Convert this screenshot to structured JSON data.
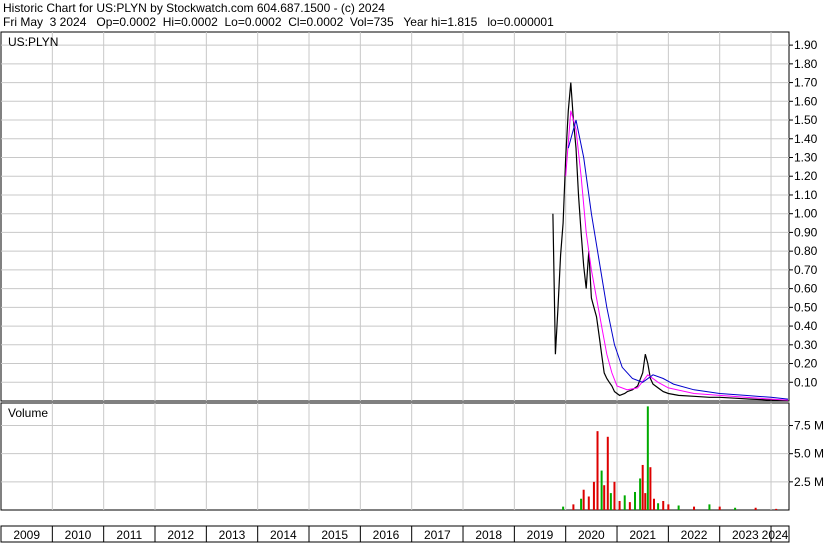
{
  "header": {
    "line1": "Historic Chart for US:PLYN by Stockwatch.com 604.687.1500 - (c) 2024",
    "line2": "Fri May  3 2024   Op=0.0002  Hi=0.0002  Lo=0.0002  Cl=0.0002  Vol=735   Year hi=1.815   lo=0.000001"
  },
  "colors": {
    "price": "#000000",
    "ma_short": "#ff00ff",
    "ma_long": "#0000cc",
    "vol_up": "#00aa00",
    "vol_down": "#dd0000",
    "grid": "#c8c8c8"
  },
  "chart_data": [
    {
      "type": "line",
      "title": "US:PLYN",
      "ylim": [
        0,
        1.97
      ],
      "ytick_labels": [
        "0.10",
        "0.20",
        "0.30",
        "0.40",
        "0.50",
        "0.60",
        "0.70",
        "0.80",
        "0.90",
        "1.00",
        "1.10",
        "1.20",
        "1.30",
        "1.40",
        "1.50",
        "1.60",
        "1.70",
        "1.80",
        "1.90"
      ],
      "xtick_labels": [
        "2009",
        "2010",
        "2011",
        "2012",
        "2013",
        "2014",
        "2015",
        "2016",
        "2017",
        "2018",
        "2019",
        "2020",
        "2021",
        "2022",
        "2023",
        "2024"
      ],
      "xlim": [
        2009.0,
        2024.35
      ],
      "series": [
        {
          "values_x": [
            2019.75,
            2019.8,
            2019.85,
            2019.9,
            2019.95,
            2020.0,
            2020.05,
            2020.1,
            2020.15,
            2020.2,
            2020.25,
            2020.3,
            2020.35,
            2020.4,
            2020.45,
            2020.5,
            2020.55,
            2020.6,
            2020.65,
            2020.7,
            2020.75,
            2020.8,
            2020.85,
            2020.9,
            2020.95,
            2021.0,
            2021.05,
            2021.1,
            2021.15,
            2021.2,
            2021.3,
            2021.4,
            2021.5,
            2021.55,
            2021.6,
            2021.65,
            2021.7,
            2021.8,
            2021.9,
            2022.0,
            2022.2,
            2022.5,
            2022.8,
            2023.0,
            2023.3,
            2023.6,
            2024.0,
            2024.33
          ],
          "values_y": [
            1.0,
            0.25,
            0.5,
            0.78,
            0.95,
            1.3,
            1.55,
            1.7,
            1.5,
            1.35,
            1.1,
            0.9,
            0.72,
            0.6,
            0.8,
            0.55,
            0.5,
            0.45,
            0.35,
            0.25,
            0.15,
            0.12,
            0.1,
            0.08,
            0.05,
            0.04,
            0.03,
            0.035,
            0.04,
            0.05,
            0.06,
            0.08,
            0.15,
            0.25,
            0.2,
            0.12,
            0.09,
            0.07,
            0.05,
            0.04,
            0.03,
            0.025,
            0.02,
            0.02,
            0.015,
            0.01,
            0.005,
            0.002
          ]
        },
        {
          "values_x": [
            2020.0,
            2020.1,
            2020.2,
            2020.3,
            2020.4,
            2020.5,
            2020.6,
            2020.7,
            2020.8,
            2020.9,
            2021.0,
            2021.2,
            2021.4,
            2021.6,
            2021.8,
            2022.0,
            2022.5,
            2023.0,
            2023.5,
            2024.0,
            2024.33
          ],
          "values_y": [
            1.2,
            1.55,
            1.45,
            1.2,
            0.9,
            0.7,
            0.55,
            0.4,
            0.25,
            0.15,
            0.08,
            0.06,
            0.07,
            0.14,
            0.1,
            0.07,
            0.04,
            0.03,
            0.02,
            0.01,
            0.005
          ]
        },
        {
          "values_x": [
            2020.05,
            2020.2,
            2020.35,
            2020.5,
            2020.65,
            2020.8,
            2020.95,
            2021.1,
            2021.3,
            2021.5,
            2021.7,
            2021.9,
            2022.1,
            2022.5,
            2023.0,
            2023.5,
            2024.0,
            2024.33
          ],
          "values_y": [
            1.35,
            1.5,
            1.3,
            1.0,
            0.75,
            0.5,
            0.3,
            0.18,
            0.12,
            0.1,
            0.14,
            0.12,
            0.09,
            0.06,
            0.04,
            0.03,
            0.02,
            0.01
          ]
        }
      ]
    },
    {
      "type": "bar",
      "title": "Volume",
      "ylim": [
        0,
        9.5
      ],
      "ytick_labels": [
        "2.5 M",
        "5.0 M",
        "7.5 M"
      ],
      "x": [
        2019.95,
        2020.15,
        2020.3,
        2020.35,
        2020.45,
        2020.55,
        2020.62,
        2020.7,
        2020.75,
        2020.82,
        2020.88,
        2020.95,
        2021.05,
        2021.15,
        2021.25,
        2021.35,
        2021.45,
        2021.5,
        2021.55,
        2021.6,
        2021.65,
        2021.72,
        2021.8,
        2021.9,
        2022.0,
        2022.2,
        2022.5,
        2022.8,
        2023.0,
        2023.3,
        2023.7,
        2024.1
      ],
      "values": [
        0.3,
        0.5,
        1.0,
        1.8,
        1.2,
        2.5,
        7.0,
        3.5,
        2.2,
        6.5,
        1.5,
        2.5,
        0.8,
        1.3,
        0.7,
        1.6,
        2.8,
        4.0,
        1.5,
        9.2,
        3.8,
        1.0,
        0.6,
        0.8,
        0.5,
        0.4,
        0.3,
        0.5,
        0.3,
        0.2,
        0.2,
        0.1
      ],
      "up": [
        1,
        0,
        1,
        0,
        0,
        0,
        0,
        1,
        0,
        0,
        1,
        0,
        0,
        1,
        0,
        1,
        1,
        0,
        0,
        1,
        0,
        0,
        1,
        0,
        0,
        1,
        0,
        1,
        0,
        1,
        0,
        0
      ]
    }
  ]
}
